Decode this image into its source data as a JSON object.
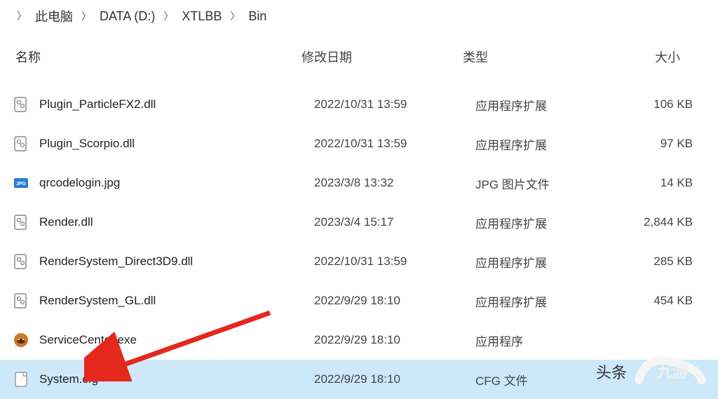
{
  "breadcrumb": [
    "此电脑",
    "DATA (D:)",
    "XTLBB",
    "Bin"
  ],
  "headers": {
    "name": "名称",
    "date": "修改日期",
    "type": "类型",
    "size": "大小"
  },
  "files": [
    {
      "icon": "dll",
      "name": "Plugin_ParticleFX2.dll",
      "date": "2022/10/31 13:59",
      "type": "应用程序扩展",
      "size": "106 KB",
      "selected": false
    },
    {
      "icon": "dll",
      "name": "Plugin_Scorpio.dll",
      "date": "2022/10/31 13:59",
      "type": "应用程序扩展",
      "size": "97 KB",
      "selected": false
    },
    {
      "icon": "jpg",
      "name": "qrcodelogin.jpg",
      "date": "2023/3/8 13:32",
      "type": "JPG 图片文件",
      "size": "14 KB",
      "selected": false
    },
    {
      "icon": "dll",
      "name": "Render.dll",
      "date": "2023/3/4 15:17",
      "type": "应用程序扩展",
      "size": "2,844 KB",
      "selected": false
    },
    {
      "icon": "dll",
      "name": "RenderSystem_Direct3D9.dll",
      "date": "2022/10/31 13:59",
      "type": "应用程序扩展",
      "size": "285 KB",
      "selected": false
    },
    {
      "icon": "dll",
      "name": "RenderSystem_GL.dll",
      "date": "2022/9/29 18:10",
      "type": "应用程序扩展",
      "size": "454 KB",
      "selected": false
    },
    {
      "icon": "exe",
      "name": "ServiceCenter.exe",
      "date": "2022/9/29 18:10",
      "type": "应用程序",
      "size": "",
      "selected": false
    },
    {
      "icon": "cfg",
      "name": "System.cfg",
      "date": "2022/9/29 18:10",
      "type": "CFG 文件",
      "size": "",
      "selected": true
    }
  ],
  "watermark1": "头条",
  "watermark2": "九游"
}
